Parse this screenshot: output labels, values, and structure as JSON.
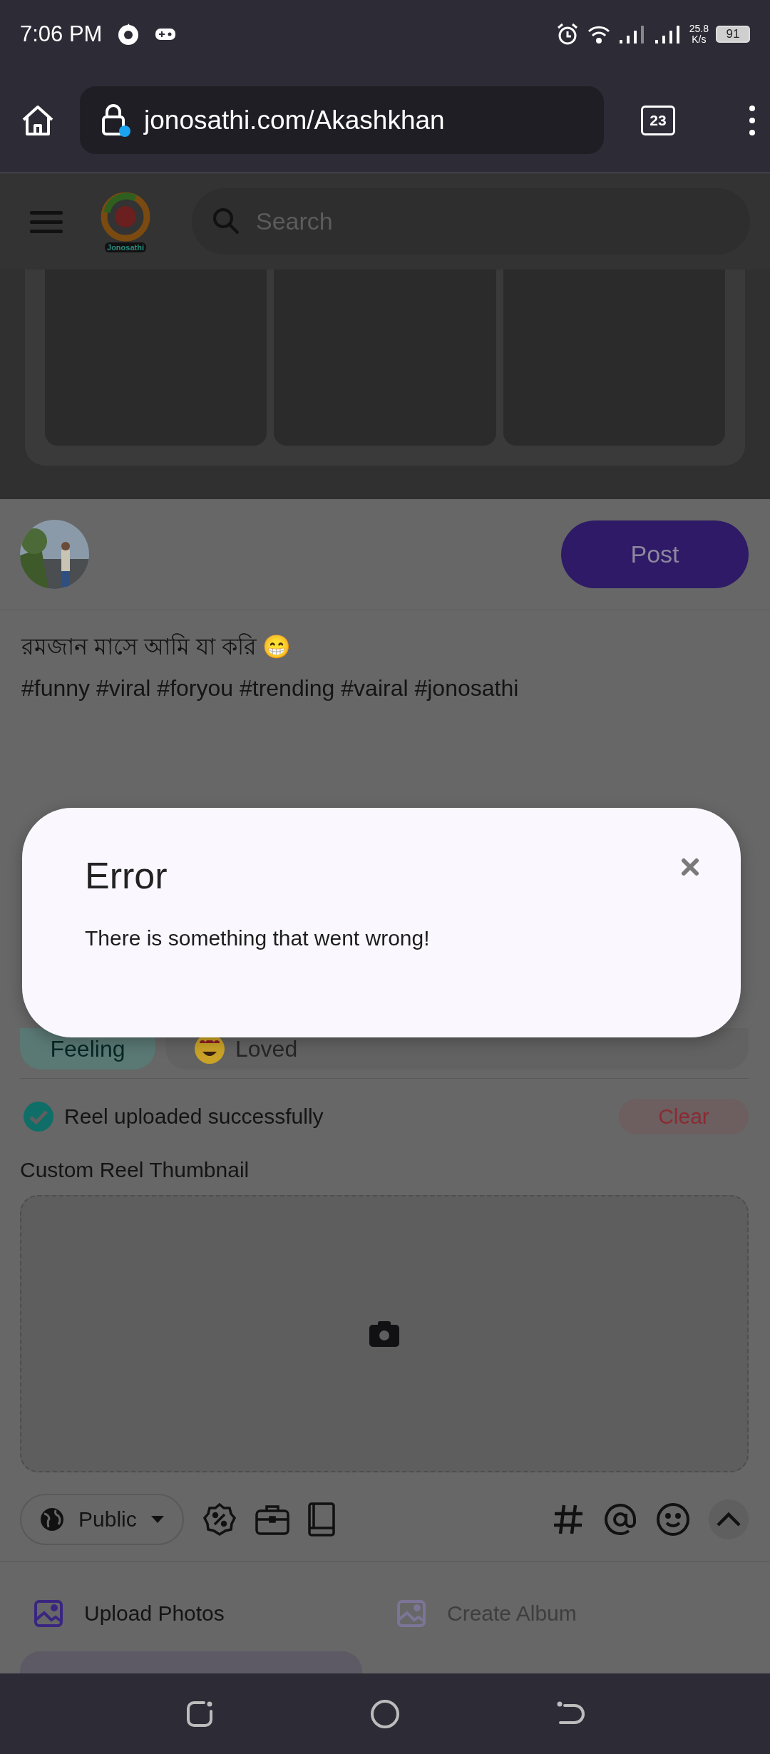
{
  "status_bar": {
    "time": "7:06 PM",
    "network_speed": "25.8",
    "network_speed_unit": "K/s",
    "battery": "91"
  },
  "browser": {
    "url": "jonosathi.com/Akashkhan",
    "tab_count": "23"
  },
  "site_header": {
    "logo_text": "Jonosathi",
    "search": {
      "placeholder": "Search"
    }
  },
  "composer": {
    "post_button": "Post",
    "caption_lines": [
      "রমজান মাসে আমি যা করি 😁",
      "#funny #viral #foryou #trending #vairal #jonosathi"
    ],
    "feeling": {
      "label": "Feeling",
      "value": "Loved"
    },
    "reel_status": {
      "text": "Reel uploaded successfully",
      "success": true,
      "clear_button": "Clear"
    },
    "thumbnail_label": "Custom Reel Thumbnail",
    "privacy": "Public",
    "actions": [
      {
        "label": "Upload Photos",
        "disabled": false
      },
      {
        "label": "Create Album",
        "disabled": true
      }
    ]
  },
  "dialog": {
    "title": "Error",
    "message": "There is something that went wrong!"
  }
}
